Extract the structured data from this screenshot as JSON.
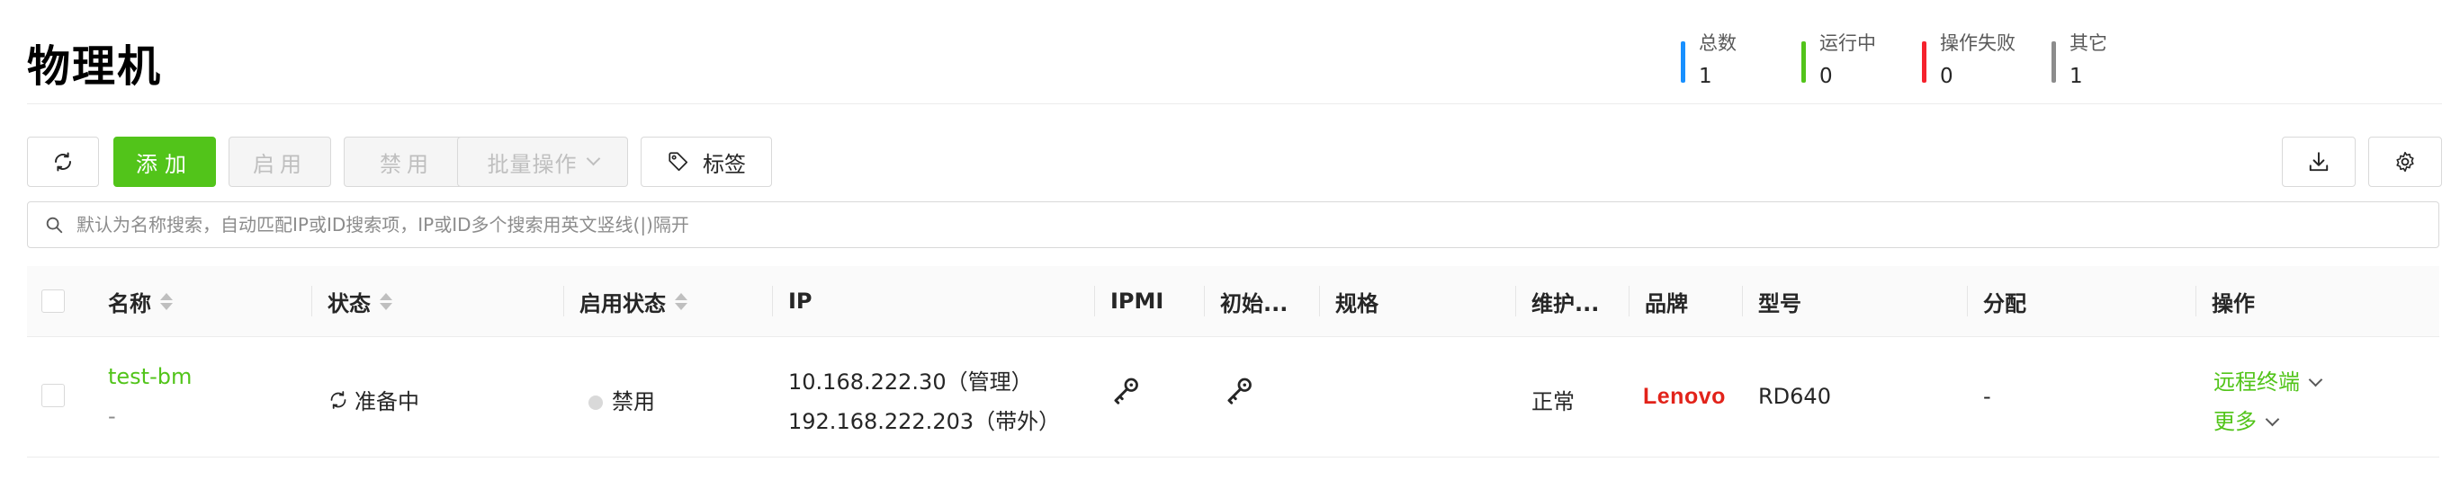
{
  "page": {
    "title": "物理机"
  },
  "stats": [
    {
      "label": "总数",
      "value": "1",
      "color": "#1890ff"
    },
    {
      "label": "运行中",
      "value": "0",
      "color": "#52c41a"
    },
    {
      "label": "操作失败",
      "value": "0",
      "color": "#f5222d"
    },
    {
      "label": "其它",
      "value": "1",
      "color": "#8c8c8c"
    }
  ],
  "toolbar": {
    "refresh_icon": "refresh-icon",
    "add_label": "添加",
    "enable_label": "启用",
    "disable_label": "禁用",
    "batch_label": "批量操作",
    "tag_label": "标签",
    "tag_icon": "tag-icon",
    "download_icon": "download-icon",
    "settings_icon": "gear-icon"
  },
  "search": {
    "placeholder": "默认为名称搜索，自动匹配IP或ID搜索项，IP或ID多个搜索用英文竖线(|)隔开",
    "icon": "search-icon"
  },
  "table": {
    "columns": [
      "名称",
      "状态",
      "启用状态",
      "IP",
      "IPMI",
      "初始...",
      "规格",
      "维护...",
      "品牌",
      "型号",
      "分配",
      "操作"
    ],
    "rows": [
      {
        "name": "test-bm",
        "description": "-",
        "status": "准备中",
        "status_icon": "sync-icon",
        "enabled": "禁用",
        "ip_manage": "10.168.222.30（管理）",
        "ip_oob": "192.168.222.203（带外）",
        "ipmi_icon": "key-icon",
        "init_icon": "key-icon",
        "spec": "",
        "maintenance": "正常",
        "brand": "Lenovo",
        "model": "RD640",
        "allocation": "-",
        "action_primary": "远程终端",
        "action_more": "更多"
      }
    ]
  },
  "colors": {
    "accent": "#52c41a",
    "brand_lenovo": "#e2231a"
  }
}
